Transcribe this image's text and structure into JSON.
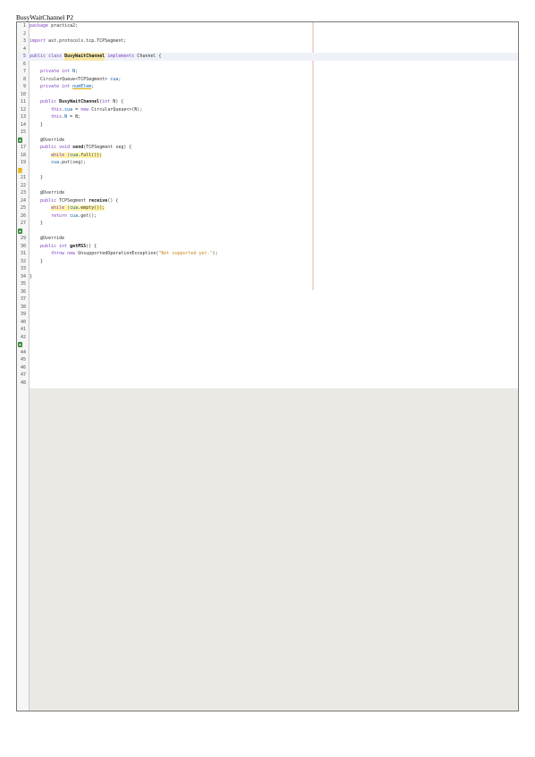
{
  "document": {
    "title": "BusyWaitChannel P2"
  },
  "editor": {
    "lines": [
      {
        "num": "1",
        "tokens": [
          {
            "t": "package",
            "c": "k"
          },
          {
            "t": " practica2;"
          }
        ]
      },
      {
        "num": "2",
        "tokens": []
      },
      {
        "num": "3",
        "tokens": [
          {
            "t": "import",
            "c": "k"
          },
          {
            "t": " ast.protocols.tcp.TCPSegment;"
          }
        ]
      },
      {
        "num": "4",
        "tokens": []
      },
      {
        "num": "5",
        "hl": true,
        "tokens": [
          {
            "t": "public class ",
            "c": "k"
          },
          {
            "t": "BusyWaitChannel",
            "c": "ctx"
          },
          {
            "t": " "
          },
          {
            "t": "implements",
            "c": "k"
          },
          {
            "t": " Channel {"
          }
        ]
      },
      {
        "num": "6",
        "tokens": []
      },
      {
        "num": "7",
        "tokens": [
          {
            "t": "    "
          },
          {
            "t": "private int ",
            "c": "k"
          },
          {
            "t": "N",
            "c": "f"
          },
          {
            "t": ";"
          }
        ]
      },
      {
        "num": "8",
        "tokens": [
          {
            "t": "    CircularQueue<TCPSegment> "
          },
          {
            "t": "cua",
            "c": "f"
          },
          {
            "t": ";"
          }
        ]
      },
      {
        "num": "9",
        "tokens": [
          {
            "t": "    "
          },
          {
            "t": "private int ",
            "c": "k"
          },
          {
            "t": "numElem",
            "c": "u f"
          },
          {
            "t": ";"
          }
        ]
      },
      {
        "num": "10",
        "tokens": []
      },
      {
        "num": "11",
        "tokens": [
          {
            "t": "    "
          },
          {
            "t": "public ",
            "c": "k"
          },
          {
            "t": "BusyWaitChannel",
            "c": "b"
          },
          {
            "t": "("
          },
          {
            "t": "int",
            "c": "k"
          },
          {
            "t": " N) {"
          }
        ]
      },
      {
        "num": "12",
        "tokens": [
          {
            "t": "        "
          },
          {
            "t": "this",
            "c": "k"
          },
          {
            "t": "."
          },
          {
            "t": "cua",
            "c": "f"
          },
          {
            "t": " = "
          },
          {
            "t": "new",
            "c": "k"
          },
          {
            "t": " CircularQueue<>(N);"
          }
        ]
      },
      {
        "num": "13",
        "tokens": [
          {
            "t": "        "
          },
          {
            "t": "this",
            "c": "k"
          },
          {
            "t": "."
          },
          {
            "t": "N",
            "c": "f"
          },
          {
            "t": " = N;"
          }
        ]
      },
      {
        "num": "14",
        "tokens": [
          {
            "t": "    }"
          }
        ]
      },
      {
        "num": "15",
        "tokens": []
      },
      {
        "num": "16",
        "marker": "over",
        "tokens": [
          {
            "t": "    @Override"
          }
        ]
      },
      {
        "num": "17",
        "tokens": [
          {
            "t": "    "
          },
          {
            "t": "public void ",
            "c": "k"
          },
          {
            "t": "send",
            "c": "b"
          },
          {
            "t": "(TCPSegment seg) {"
          }
        ]
      },
      {
        "num": "18",
        "tokens": [
          {
            "t": "        "
          },
          {
            "t": "while (",
            "c": "y k"
          },
          {
            "t": "cua",
            "c": "y f"
          },
          {
            "t": ".full());",
            "c": "y"
          }
        ]
      },
      {
        "num": "19",
        "tokens": [
          {
            "t": "        "
          },
          {
            "t": "cua",
            "c": "f"
          },
          {
            "t": ".put(seg);"
          }
        ]
      },
      {
        "num": "20",
        "marker": "warn",
        "tokens": []
      },
      {
        "num": "21",
        "tokens": [
          {
            "t": "    }"
          }
        ]
      },
      {
        "num": "22",
        "tokens": []
      },
      {
        "num": "23",
        "tokens": [
          {
            "t": "    @Override"
          }
        ]
      },
      {
        "num": "24",
        "tokens": [
          {
            "t": "    "
          },
          {
            "t": "public",
            "c": "k"
          },
          {
            "t": " TCPSegment "
          },
          {
            "t": "receive",
            "c": "b"
          },
          {
            "t": "() {"
          }
        ]
      },
      {
        "num": "25",
        "tokens": [
          {
            "t": "        "
          },
          {
            "t": "while (",
            "c": "y k"
          },
          {
            "t": "cua",
            "c": "y f"
          },
          {
            "t": ".empty());",
            "c": "y"
          }
        ]
      },
      {
        "num": "26",
        "tokens": [
          {
            "t": "        "
          },
          {
            "t": "return ",
            "c": "k"
          },
          {
            "t": "cua",
            "c": "f"
          },
          {
            "t": ".get();"
          }
        ]
      },
      {
        "num": "27",
        "tokens": [
          {
            "t": "    }"
          }
        ]
      },
      {
        "num": "28",
        "marker": "over",
        "tokens": []
      },
      {
        "num": "29",
        "tokens": [
          {
            "t": "    @Override"
          }
        ]
      },
      {
        "num": "30",
        "tokens": [
          {
            "t": "    "
          },
          {
            "t": "public int ",
            "c": "k"
          },
          {
            "t": "getMSS",
            "c": "b"
          },
          {
            "t": "() {"
          }
        ]
      },
      {
        "num": "31",
        "tokens": [
          {
            "t": "        "
          },
          {
            "t": "throw new",
            "c": "k"
          },
          {
            "t": " UnsupportedOperationException("
          },
          {
            "t": "\"Not supported yet.\"",
            "c": "s"
          },
          {
            "t": ");"
          }
        ]
      },
      {
        "num": "32",
        "tokens": [
          {
            "t": "    }"
          }
        ]
      },
      {
        "num": "33",
        "tokens": []
      },
      {
        "num": "34",
        "tokens": [
          {
            "t": "}"
          }
        ]
      },
      {
        "num": "35",
        "tokens": []
      },
      {
        "num": "36",
        "tokens": []
      },
      {
        "num": "37",
        "tokens": []
      },
      {
        "num": "38",
        "tokens": []
      },
      {
        "num": "39",
        "tokens": []
      },
      {
        "num": "40",
        "tokens": []
      },
      {
        "num": "41",
        "tokens": []
      },
      {
        "num": "42",
        "tokens": []
      },
      {
        "num": "43",
        "marker": "over",
        "tokens": []
      },
      {
        "num": "44",
        "tokens": []
      },
      {
        "num": "45",
        "tokens": []
      },
      {
        "num": "46",
        "tokens": []
      },
      {
        "num": "47",
        "tokens": []
      },
      {
        "num": "48",
        "tokens": []
      }
    ]
  }
}
